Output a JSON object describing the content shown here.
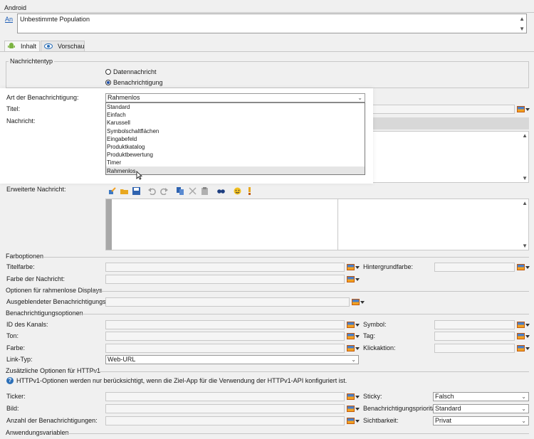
{
  "header": {
    "title": "Android",
    "link": "An",
    "audience": "Unbestimmte Population"
  },
  "tabs": [
    {
      "label": "Inhalt"
    },
    {
      "label": "Vorschau"
    }
  ],
  "message_type": {
    "legend": "Nachrichtentyp",
    "option_data": "Datennachricht",
    "option_notification": "Benachrichtigung"
  },
  "labels": {
    "notification_type": "Art der Benachrichtigung:",
    "title": "Titel:",
    "message": "Nachricht:",
    "extended_message": "Erweiterte Nachricht:",
    "color_options": "Farboptionen",
    "title_color": "Titelfarbe:",
    "background_color": "Hintergrundfarbe:",
    "message_color": "Farbe der Nachricht:",
    "borderless_options": "Optionen für rahmenlose Displays",
    "hidden_style": "Ausgeblendeter Benachrichtigungsstil:",
    "notification_options": "Benachrichtigungsoptionen",
    "channel_id": "ID des Kanals:",
    "symbol": "Symbol:",
    "sound": "Ton:",
    "tag": "Tag:",
    "color": "Farbe:",
    "click_action": "Klickaktion:",
    "link_type": "Link-Typ:",
    "http_section": "Zusätzliche Optionen für HTTPv1",
    "http_info": "HTTPv1-Optionen werden nur berücksichtigt, wenn die Ziel-App für die Verwendung der HTTPv1-API konfiguriert ist.",
    "ticker": "Ticker:",
    "sticky": "Sticky:",
    "image": "Bild:",
    "priority": "Benachrichtigungspriorität:",
    "count": "Anzahl der Benachrichtigungen:",
    "visibility": "Sichtbarkeit:",
    "app_variables": "Anwendungsvariablen"
  },
  "values": {
    "notification_type": "Rahmenlos",
    "link_type": "Web-URL",
    "sticky": "Falsch",
    "priority": "Standard",
    "visibility": "Privat"
  },
  "dropdown_options": [
    "Standard",
    "Einfach",
    "Karussell",
    "Symbolschaltflächen",
    "Eingabefeld",
    "Produktkatalog",
    "Produktbewertung",
    "Timer",
    "Rahmenlos"
  ],
  "icons": [
    "android-icon",
    "eye-icon",
    "pencil-icon",
    "folder-icon",
    "save-icon",
    "undo-icon",
    "redo-icon",
    "copy-icon",
    "cut-icon",
    "paste-icon",
    "find-icon",
    "emoji-icon",
    "personalize-icon",
    "color-picker-icon",
    "info-icon"
  ]
}
